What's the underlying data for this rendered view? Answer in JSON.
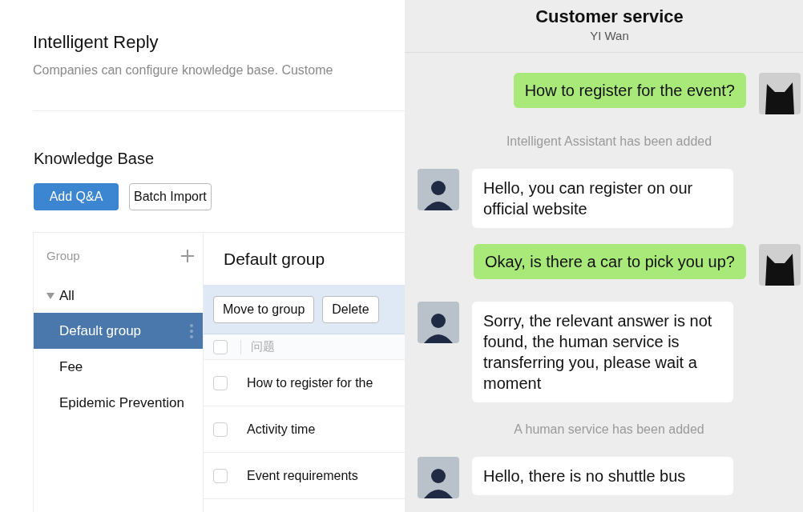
{
  "page": {
    "title": "Intelligent Reply",
    "description": "Companies can configure knowledge base. Custome"
  },
  "knowledge_base": {
    "title": "Knowledge Base",
    "buttons": [
      {
        "label": "Add Q&A",
        "kind": "primary"
      },
      {
        "label": "Batch Import",
        "kind": "default"
      }
    ]
  },
  "groups": {
    "title": "Group",
    "items": [
      {
        "label": "All",
        "expanded": true,
        "selected": false,
        "children": [
          {
            "label": "Default group",
            "selected": true
          },
          {
            "label": "Fee",
            "selected": false
          },
          {
            "label": "Epidemic Prevention",
            "selected": false
          }
        ]
      }
    ]
  },
  "list": {
    "title": "Default group",
    "actions": [
      "Move to group",
      "Delete"
    ],
    "column_header": "问题",
    "header_checked": false,
    "rows": [
      {
        "question": "How to register for the",
        "checked": false
      },
      {
        "question": "Activity time",
        "checked": false
      },
      {
        "question": "Event requirements",
        "checked": false
      }
    ]
  },
  "chat": {
    "title": "Customer service",
    "subtitle": "YI Wan",
    "messages": [
      {
        "kind": "sent",
        "text": "How to register for the event?"
      },
      {
        "kind": "notice",
        "text": "Intelligent Assistant has been added"
      },
      {
        "kind": "received",
        "text": "Hello, you can register on our official website"
      },
      {
        "kind": "sent",
        "text": "Okay, is there a car to pick you up?"
      },
      {
        "kind": "received",
        "text": "Sorry, the relevant answer is not found, the human service is transferring you, please wait a moment"
      },
      {
        "kind": "notice",
        "text": "A human service has been added"
      },
      {
        "kind": "received",
        "text": "Hello, there is no shuttle bus"
      }
    ]
  }
}
